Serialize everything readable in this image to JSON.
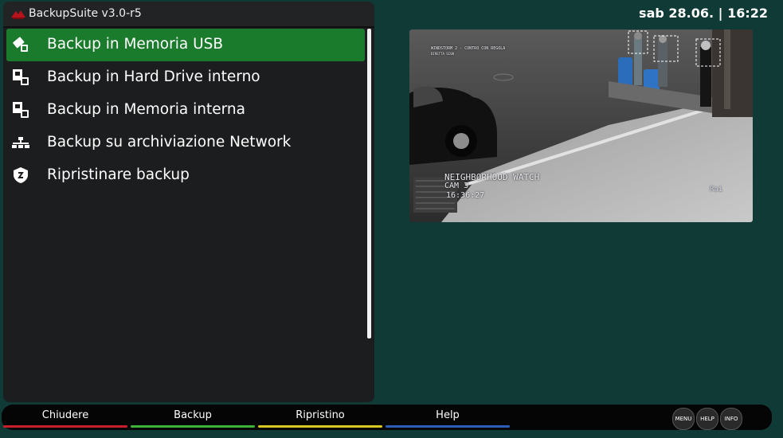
{
  "header": {
    "app_title": "BackupSuite v3.0-r5",
    "clock": "sab 28.06. | 16:22"
  },
  "menu": {
    "selected_index": 0,
    "items": [
      {
        "label": "Backup in Memoria USB",
        "icon": "usb-drive-icon"
      },
      {
        "label": "Backup in Hard Drive interno",
        "icon": "hard-drive-icon"
      },
      {
        "label": "Backup in Memoria interna",
        "icon": "internal-memory-icon"
      },
      {
        "label": "Backup su archiviazione Network",
        "icon": "network-icon"
      },
      {
        "label": "Ripristinare backup",
        "icon": "restore-shield-icon"
      }
    ]
  },
  "preview": {
    "top_caption_line1": "WINDSTORM 2 - CONTRO CON REGOLA",
    "top_caption_line2": "DIRETTA SIGN",
    "osd_line1": "NEIGHBORHOOD WATCH",
    "osd_line2": "CAM 3",
    "osd_line3": "16:36:27",
    "channel_logo": "Rai"
  },
  "footer": {
    "keys": [
      {
        "label": "Chiudere",
        "color": "#c8202a"
      },
      {
        "label": "Backup",
        "color": "#3fb23a"
      },
      {
        "label": "Ripristino",
        "color": "#d8c821"
      },
      {
        "label": "Help",
        "color": "#2e5fb8"
      }
    ],
    "buttons": [
      "MENU",
      "HELP",
      "INFO"
    ]
  },
  "colors": {
    "background": "#0f3a36",
    "panel": "#1c1d1e",
    "selection": "#1b7b2c"
  }
}
